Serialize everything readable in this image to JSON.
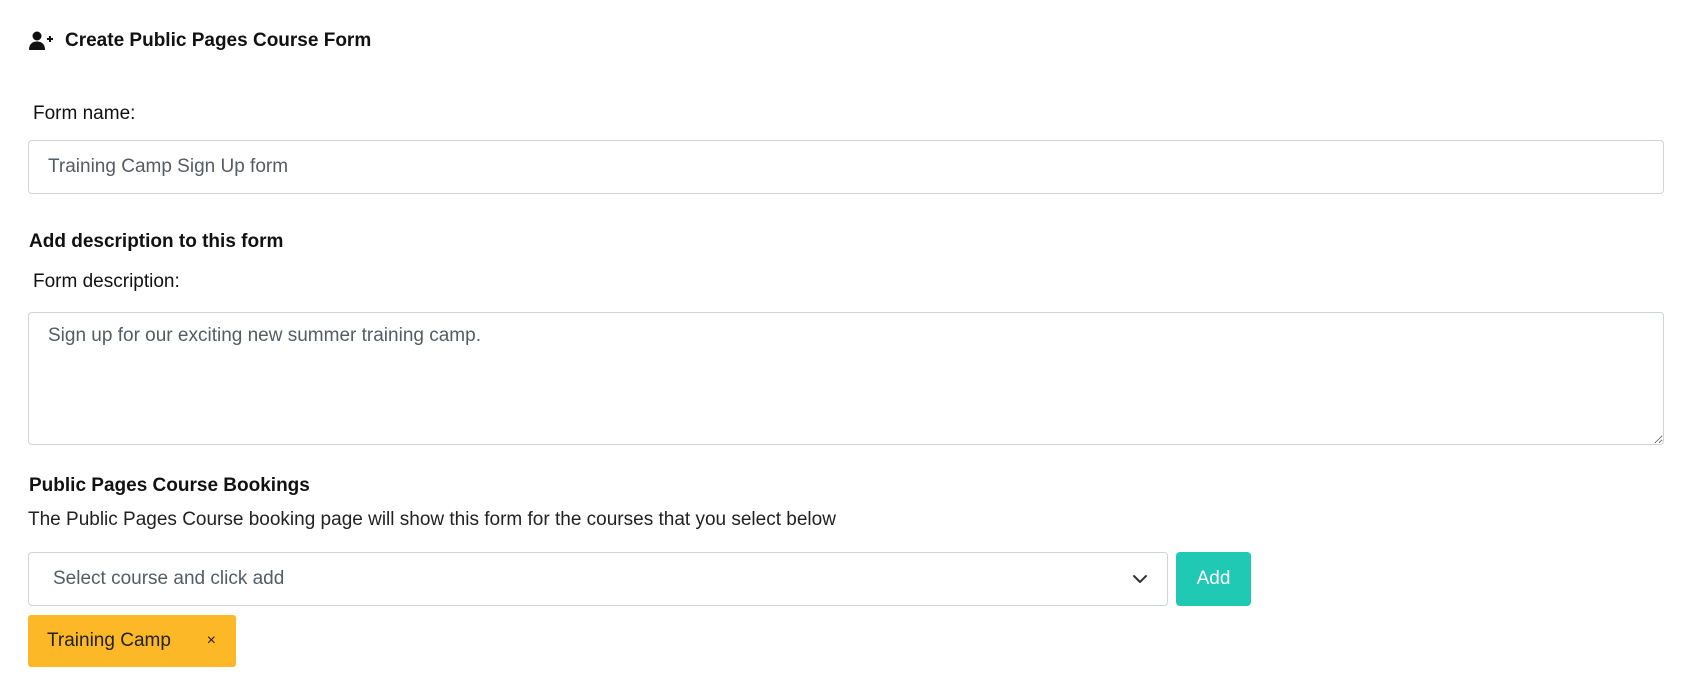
{
  "header": {
    "icon": "user-plus-icon",
    "title": "Create Public Pages Course Form"
  },
  "form_name": {
    "label": "Form name:",
    "value": "Training Camp Sign Up form"
  },
  "description_section": {
    "title": "Add description to this form",
    "label": "Form description:",
    "value": "Sign up for our exciting new summer training camp."
  },
  "bookings": {
    "title": "Public Pages Course Bookings",
    "description": "The Public Pages Course booking page will show this form for the courses that you select below",
    "select_placeholder": "Select course and click add",
    "add_label": "Add",
    "selected_courses": [
      {
        "label": "Training Camp",
        "remove": "×"
      }
    ]
  },
  "colors": {
    "accent": "#20c9b4",
    "tag": "#fdb827"
  }
}
